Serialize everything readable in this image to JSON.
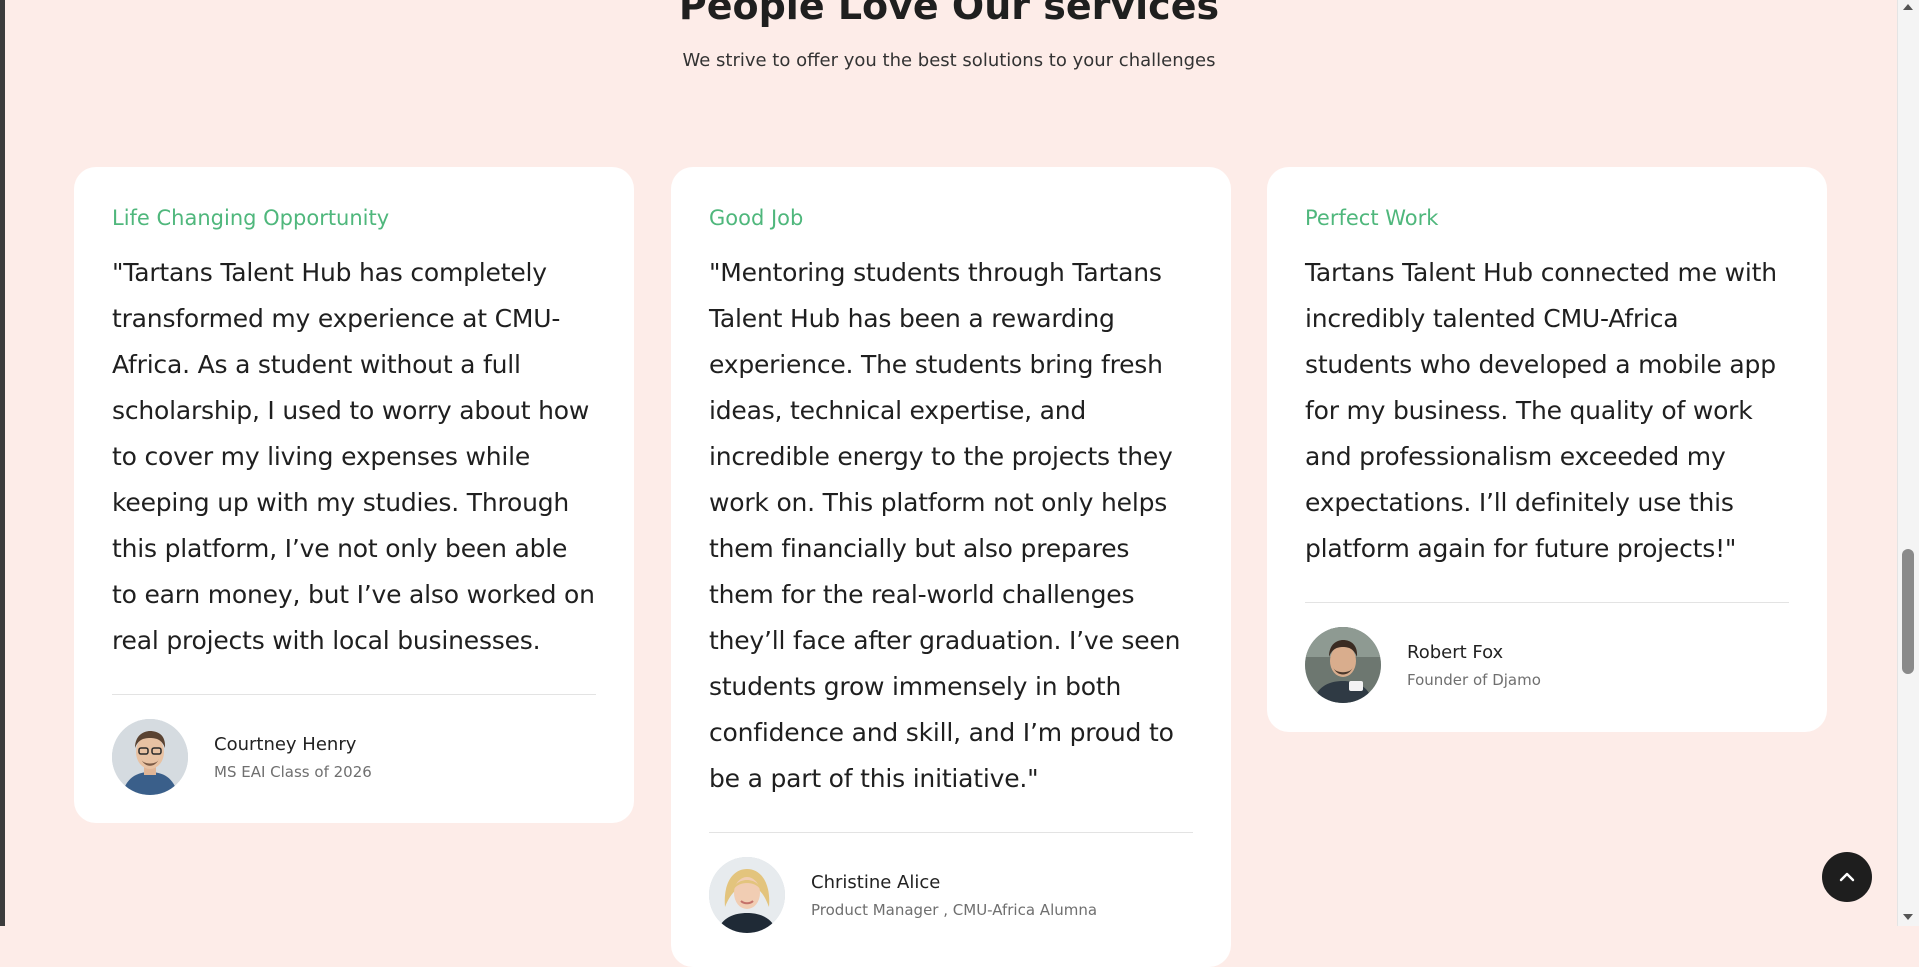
{
  "section": {
    "title": "People Love Our services",
    "subtitle": "We strive to offer you the best solutions to your challenges"
  },
  "testimonials": [
    {
      "tag": "Life Changing Opportunity",
      "quote": "\"Tartans Talent Hub has completely transformed my experience at CMU-Africa. As a student without a full scholarship, I used to worry about how to cover my living expenses while keeping up with my studies. Through this platform, I’ve not only been able to earn money, but I’ve also worked on real projects with local businesses.",
      "name": "Courtney Henry",
      "role": "MS EAI Class of 2026"
    },
    {
      "tag": "Good Job",
      "quote": "\"Mentoring students through Tartans Talent Hub has been a rewarding experience. The students bring fresh ideas, technical expertise, and incredible energy to the projects they work on. This platform not only helps them financially but also prepares them for the real-world challenges they’ll face after graduation. I’ve seen students grow immensely in both confidence and skill, and I’m proud to be a part of this initiative.\"",
      "name": "Christine Alice",
      "role": "Product Manager , CMU-Africa Alumna"
    },
    {
      "tag": "Perfect Work",
      "quote": "Tartans Talent Hub connected me with incredibly talented CMU-Africa students who developed a mobile app for my business. The quality of work and professionalism exceeded my expectations. I’ll definitely use this platform again for future projects!\"",
      "name": "Robert Fox",
      "role": "Founder of Djamo"
    }
  ],
  "back_to_top": {
    "icon": "chevron-up-icon"
  },
  "colors": {
    "background": "#fdece8",
    "card": "#ffffff",
    "accent": "#4fb77c",
    "text": "#1f1f1f",
    "button": "#1e1e1e"
  }
}
